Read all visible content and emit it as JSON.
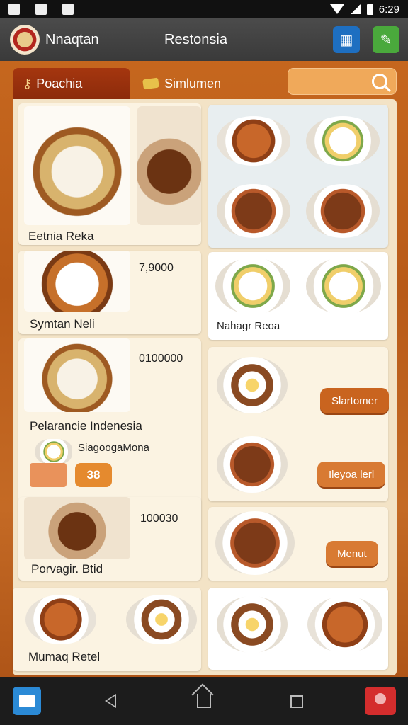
{
  "status_bar": {
    "time": "6:29"
  },
  "app_bar": {
    "app_name": "Nnaqtan",
    "title": "Restonsia"
  },
  "tabs": [
    {
      "label": "Poachia"
    },
    {
      "label": "Simlumen"
    }
  ],
  "left_items": [
    {
      "name": "Eetnia Reka",
      "price": ""
    },
    {
      "name": "Symtan Neli",
      "price": "7,9000"
    },
    {
      "name": "Pelarancie Indenesia",
      "price": "0100000"
    },
    {
      "name": "SiagoogaMona",
      "badge": "38"
    },
    {
      "name": "Porvagir. Btid",
      "price": "100030"
    },
    {
      "name": "Mumaq Retel",
      "price": ""
    }
  ],
  "right_items": [
    {
      "name": "Nahagr Reoa"
    }
  ],
  "action_buttons": {
    "slartomer": "Slartomer",
    "ileyoa_lerl": "Ileyoa lerl",
    "menut": "Menut"
  }
}
